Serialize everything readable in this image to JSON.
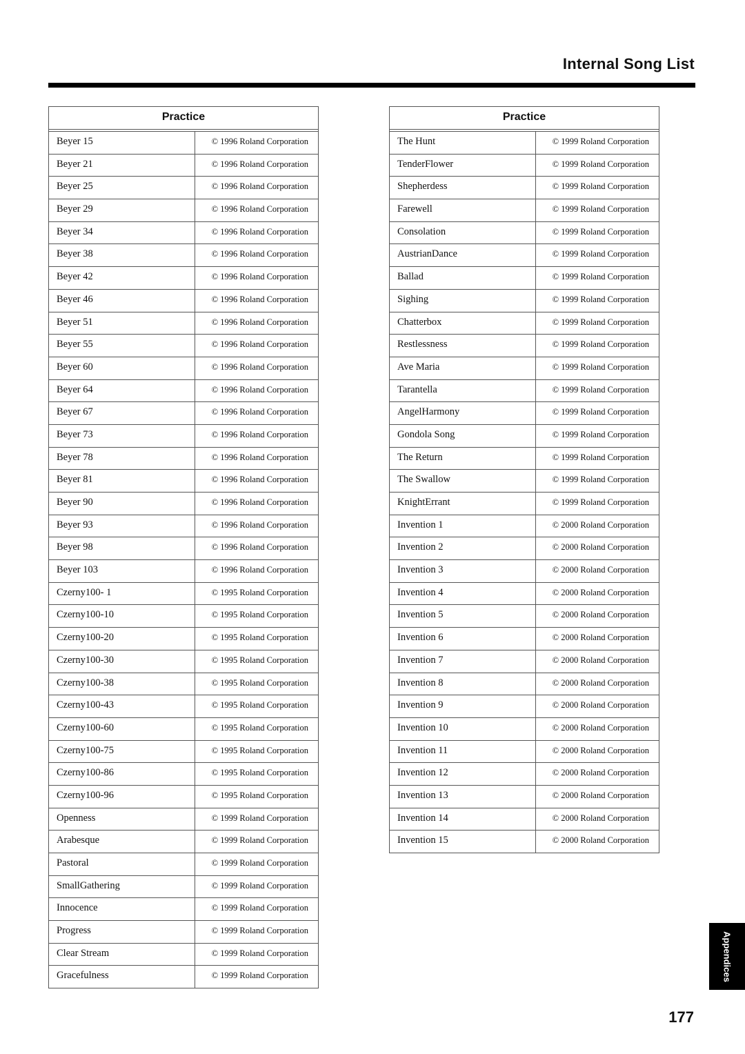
{
  "header": {
    "title": "Internal Song List"
  },
  "tables": [
    {
      "heading": "Practice",
      "rows": [
        [
          "Beyer 15",
          "© 1996 Roland Corporation"
        ],
        [
          "Beyer 21",
          "© 1996 Roland Corporation"
        ],
        [
          "Beyer 25",
          "© 1996 Roland Corporation"
        ],
        [
          "Beyer 29",
          "© 1996 Roland Corporation"
        ],
        [
          "Beyer 34",
          "© 1996 Roland Corporation"
        ],
        [
          "Beyer 38",
          "© 1996 Roland Corporation"
        ],
        [
          "Beyer 42",
          "© 1996 Roland Corporation"
        ],
        [
          "Beyer 46",
          "© 1996 Roland Corporation"
        ],
        [
          "Beyer 51",
          "© 1996 Roland Corporation"
        ],
        [
          "Beyer 55",
          "© 1996 Roland Corporation"
        ],
        [
          "Beyer 60",
          "© 1996 Roland Corporation"
        ],
        [
          "Beyer 64",
          "© 1996 Roland Corporation"
        ],
        [
          "Beyer 67",
          "© 1996 Roland Corporation"
        ],
        [
          "Beyer 73",
          "© 1996 Roland Corporation"
        ],
        [
          "Beyer 78",
          "© 1996 Roland Corporation"
        ],
        [
          "Beyer 81",
          "© 1996 Roland Corporation"
        ],
        [
          "Beyer 90",
          "© 1996 Roland Corporation"
        ],
        [
          "Beyer 93",
          "© 1996 Roland Corporation"
        ],
        [
          "Beyer 98",
          "© 1996 Roland Corporation"
        ],
        [
          "Beyer 103",
          "© 1996 Roland Corporation"
        ],
        [
          "Czerny100- 1",
          "© 1995 Roland Corporation"
        ],
        [
          "Czerny100-10",
          "© 1995 Roland Corporation"
        ],
        [
          "Czerny100-20",
          "© 1995 Roland Corporation"
        ],
        [
          "Czerny100-30",
          "© 1995 Roland Corporation"
        ],
        [
          "Czerny100-38",
          "© 1995 Roland Corporation"
        ],
        [
          "Czerny100-43",
          "© 1995 Roland Corporation"
        ],
        [
          "Czerny100-60",
          "© 1995 Roland Corporation"
        ],
        [
          "Czerny100-75",
          "© 1995 Roland Corporation"
        ],
        [
          "Czerny100-86",
          "© 1995 Roland Corporation"
        ],
        [
          "Czerny100-96",
          "© 1995 Roland Corporation"
        ],
        [
          "Openness",
          "© 1999 Roland Corporation"
        ],
        [
          "Arabesque",
          "© 1999 Roland Corporation"
        ],
        [
          "Pastoral",
          "© 1999 Roland Corporation"
        ],
        [
          "SmallGathering",
          "© 1999 Roland Corporation"
        ],
        [
          "Innocence",
          "© 1999 Roland Corporation"
        ],
        [
          "Progress",
          "© 1999 Roland Corporation"
        ],
        [
          "Clear Stream",
          "© 1999 Roland Corporation"
        ],
        [
          "Gracefulness",
          "© 1999 Roland Corporation"
        ]
      ]
    },
    {
      "heading": "Practice",
      "rows": [
        [
          "The Hunt",
          "© 1999 Roland Corporation"
        ],
        [
          "TenderFlower",
          "© 1999 Roland Corporation"
        ],
        [
          "Shepherdess",
          "© 1999 Roland Corporation"
        ],
        [
          "Farewell",
          "© 1999 Roland Corporation"
        ],
        [
          "Consolation",
          "© 1999 Roland Corporation"
        ],
        [
          "AustrianDance",
          "© 1999 Roland Corporation"
        ],
        [
          "Ballad",
          "© 1999 Roland Corporation"
        ],
        [
          "Sighing",
          "© 1999 Roland Corporation"
        ],
        [
          "Chatterbox",
          "© 1999 Roland Corporation"
        ],
        [
          "Restlessness",
          "© 1999 Roland Corporation"
        ],
        [
          "Ave Maria",
          "© 1999 Roland Corporation"
        ],
        [
          "Tarantella",
          "© 1999 Roland Corporation"
        ],
        [
          "AngelHarmony",
          "© 1999 Roland Corporation"
        ],
        [
          "Gondola Song",
          "© 1999 Roland Corporation"
        ],
        [
          "The Return",
          "© 1999 Roland Corporation"
        ],
        [
          "The Swallow",
          "© 1999 Roland Corporation"
        ],
        [
          "KnightErrant",
          "© 1999 Roland Corporation"
        ],
        [
          "Invention 1",
          "© 2000 Roland Corporation"
        ],
        [
          "Invention 2",
          "© 2000 Roland Corporation"
        ],
        [
          "Invention 3",
          "© 2000 Roland Corporation"
        ],
        [
          "Invention 4",
          "© 2000 Roland Corporation"
        ],
        [
          "Invention 5",
          "© 2000 Roland Corporation"
        ],
        [
          "Invention 6",
          "© 2000 Roland Corporation"
        ],
        [
          "Invention 7",
          "© 2000 Roland Corporation"
        ],
        [
          "Invention 8",
          "© 2000 Roland Corporation"
        ],
        [
          "Invention 9",
          "© 2000 Roland Corporation"
        ],
        [
          "Invention 10",
          "© 2000 Roland Corporation"
        ],
        [
          "Invention 11",
          "© 2000 Roland Corporation"
        ],
        [
          "Invention 12",
          "© 2000 Roland Corporation"
        ],
        [
          "Invention 13",
          "© 2000 Roland Corporation"
        ],
        [
          "Invention 14",
          "© 2000 Roland Corporation"
        ],
        [
          "Invention 15",
          "© 2000 Roland Corporation"
        ]
      ]
    }
  ],
  "side_tab": {
    "label": "Appendices"
  },
  "footer": {
    "page_number": "177"
  }
}
